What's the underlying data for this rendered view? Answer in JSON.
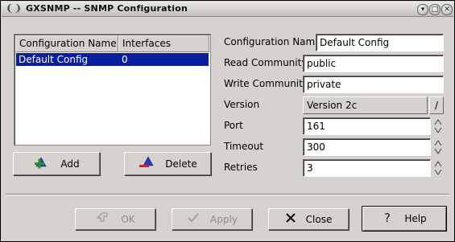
{
  "window": {
    "title": "GXSNMP -- SNMP Configuration"
  },
  "list": {
    "columns": [
      "Configuration Name",
      "Interfaces"
    ],
    "rows": [
      {
        "name": "Default Config",
        "interfaces": "0",
        "selected": true
      }
    ]
  },
  "actions": {
    "add_label": "Add",
    "delete_label": "Delete"
  },
  "form": {
    "configuration_name_label": "Configuration Name",
    "configuration_name_value": "Default Config",
    "read_community_label": "Read Community",
    "read_community_value": "public",
    "write_community_label": "Write Community",
    "write_community_value": "private",
    "version_label": "Version",
    "version_value": "Version 2c",
    "port_label": "Port",
    "port_value": "161",
    "timeout_label": "Timeout",
    "timeout_value": "300",
    "retries_label": "Retries",
    "retries_value": "3"
  },
  "footer": {
    "ok_label": "OK",
    "apply_label": "Apply",
    "close_label": "Close",
    "help_label": "Help"
  },
  "colors": {
    "selection": "#0a1ea0",
    "window_bg": "#d6d3ce"
  }
}
